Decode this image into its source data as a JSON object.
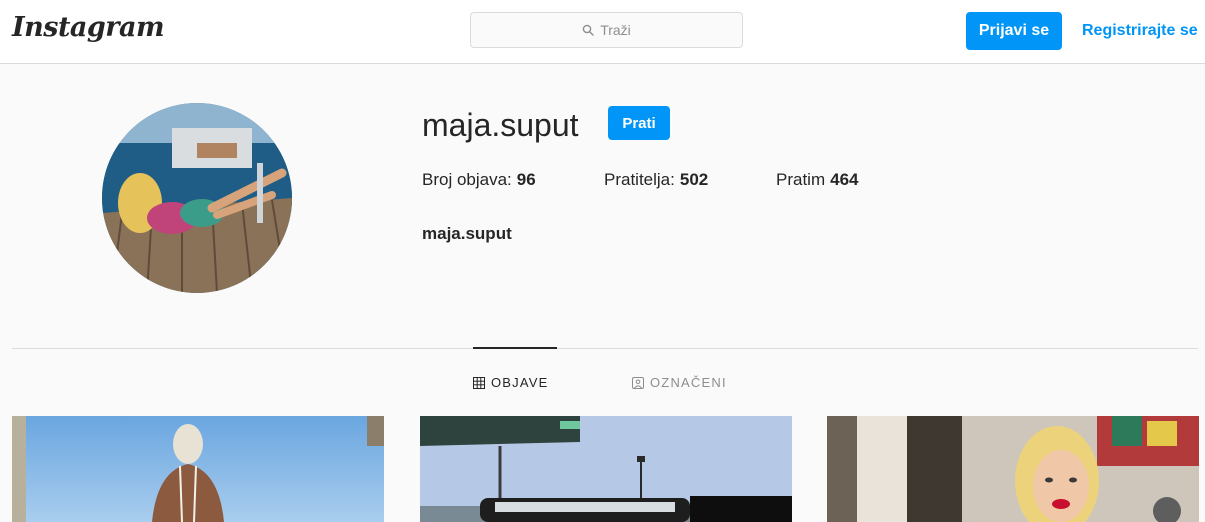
{
  "header": {
    "logo_text": "Instagram",
    "search_placeholder": "Traži",
    "login_label": "Prijavi se",
    "register_label": "Registrirajte se"
  },
  "profile": {
    "username": "maja.suput",
    "follow_label": "Prati",
    "stats": {
      "posts_label": "Broj objava:",
      "posts_count": "96",
      "followers_label": "Pratitelja:",
      "followers_count": "502",
      "following_label": "Pratim",
      "following_count": "464"
    },
    "full_name": "maja.suput"
  },
  "tabs": [
    {
      "label": "OBJAVE",
      "icon": "grid-icon",
      "active": true
    },
    {
      "label": "OZNAČENI",
      "icon": "tagged-icon",
      "active": false
    }
  ],
  "colors": {
    "accent": "#0095f6",
    "background": "#fafafa",
    "border": "#dbdbdb",
    "text": "#262626",
    "muted": "#8e8e8e"
  }
}
